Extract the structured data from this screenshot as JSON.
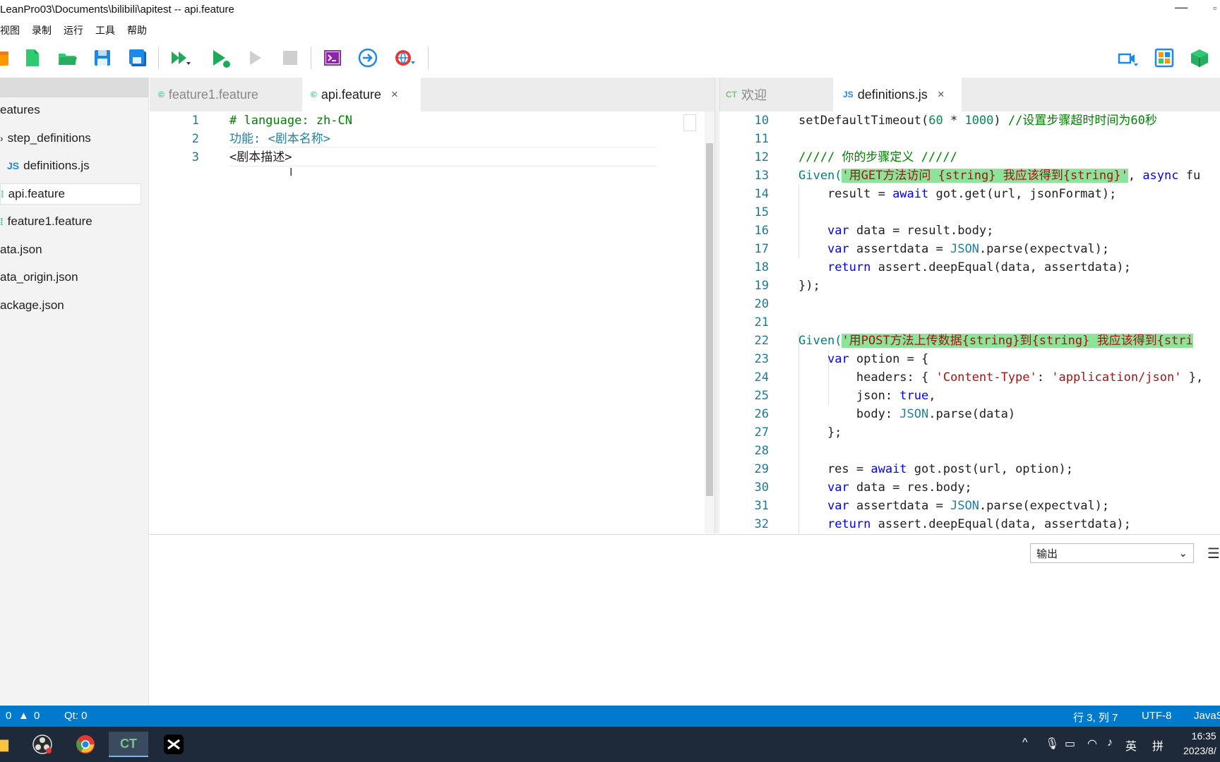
{
  "window": {
    "title": "LeanPro03\\Documents\\bilibili\\apitest -- api.feature",
    "minimize": "—",
    "maximize": "▫"
  },
  "menu": [
    "视图",
    "录制",
    "运行",
    "工具",
    "帮助"
  ],
  "toolbar": {
    "icons": [
      "new-project-icon",
      "new-file-icon",
      "open-folder-icon",
      "save-icon",
      "save-all-icon",
      "run-all-icon",
      "run-icon",
      "play-icon",
      "stop-icon",
      "terminal-icon",
      "navigate-icon",
      "web-icon",
      "record-icon",
      "object-model-icon",
      "package-icon"
    ]
  },
  "explorer": {
    "items": [
      {
        "label": "eatures",
        "icon": ""
      },
      {
        "label": "step_definitions",
        "icon": "›"
      },
      {
        "label": "definitions.js",
        "icon": "JS"
      },
      {
        "label": "api.feature",
        "icon": "⁞"
      },
      {
        "label": "feature1.feature",
        "icon": "⁞"
      },
      {
        "label": "ata.json",
        "icon": ""
      },
      {
        "label": "ata_origin.json",
        "icon": ""
      },
      {
        "label": "ackage.json",
        "icon": ""
      }
    ]
  },
  "left_tabs": [
    {
      "label": "feature1.feature",
      "icon": "©"
    },
    {
      "label": "api.feature",
      "icon": "©",
      "close": "×"
    }
  ],
  "right_tabs": [
    {
      "label": "欢迎",
      "icon": "CT"
    },
    {
      "label": "definitions.js",
      "icon": "JS",
      "close": "×"
    }
  ],
  "left_code": {
    "line_numbers": [
      "1",
      "2",
      "3"
    ],
    "lines": [
      "# language: zh-CN",
      "功能: <剧本名称>",
      "<剧本描述>"
    ]
  },
  "right_code": {
    "line_numbers": [
      "10",
      "11",
      "12",
      "13",
      "14",
      "15",
      "16",
      "17",
      "18",
      "19",
      "20",
      "21",
      "22",
      "23",
      "24",
      "25",
      "26",
      "27",
      "28",
      "29",
      "30",
      "31",
      "32"
    ],
    "l10a": "setDefaultTimeout(",
    "l10b": "60",
    "l10c": " * ",
    "l10d": "1000",
    "l10e": ") ",
    "l10f": "//设置步骤超时时间为60秒",
    "l12": "///// 你的步骤定义 /////",
    "l13a": "Given(",
    "l13b": "'用GET方法访问 {string} 我应该得到{string}'",
    "l13c": ", ",
    "l13d": "async",
    "l13e": " fu",
    "l14a": "    result = ",
    "l14b": "await",
    "l14c": " got.get(url, jsonFormat);",
    "l16a": "    ",
    "l16b": "var",
    "l16c": " data = result.body;",
    "l17a": "    ",
    "l17b": "var",
    "l17c": " assertdata = ",
    "l17d": "JSON",
    "l17e": ".parse(expectval);",
    "l18a": "    ",
    "l18b": "return",
    "l18c": " assert.deepEqual(data, assertdata);",
    "l19": "});",
    "l22a": "Given(",
    "l22b": "'用POST方法上传数据{string}到{string} 我应该得到{stri",
    "l23a": "    ",
    "l23b": "var",
    "l23c": " option = {",
    "l24a": "        headers: { ",
    "l24b": "'Content-Type'",
    "l24c": ": ",
    "l24d": "'application/json'",
    "l24e": " },",
    "l25a": "        json: ",
    "l25b": "true",
    "l25c": ",",
    "l26a": "        body: ",
    "l26b": "JSON",
    "l26c": ".parse(data)",
    "l27": "    };",
    "l29a": "    res = ",
    "l29b": "await",
    "l29c": " got.post(url, option);",
    "l30a": "    ",
    "l30b": "var",
    "l30c": " data = res.body;",
    "l31a": "    ",
    "l31b": "var",
    "l31c": " assertdata = ",
    "l31d": "JSON",
    "l31e": ".parse(expectval);",
    "l32a": "    ",
    "l32b": "return",
    "l32c": " assert.deepEqual(data, assertdata);"
  },
  "output": {
    "selected": "输出",
    "chevron": "⌄",
    "menu": "☰"
  },
  "status": {
    "errors": "0",
    "warnings": "0",
    "qt": "Qt: 0",
    "position": "行 3, 列 7",
    "encoding": "UTF-8",
    "language": "JavaS"
  },
  "taskbar": {
    "time": "16:35",
    "date": "2023/8/",
    "ime": "英",
    "ime2": "拼",
    "chevron": "^"
  },
  "colors": {
    "statusbar": "#007acc",
    "taskbar": "#1e2a3a",
    "highlight": "#8ee39a"
  }
}
